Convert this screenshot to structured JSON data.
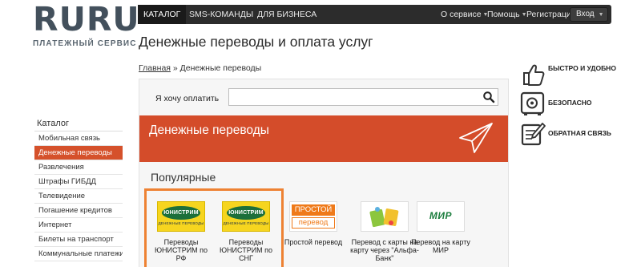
{
  "logo": {
    "word": "RURU",
    "subtitle": "ПЛАТЕЖНЫЙ СЕРВИС"
  },
  "nav": {
    "items": [
      {
        "label": "КАТАЛОГ"
      },
      {
        "label": "SMS-КОМАНДЫ"
      },
      {
        "label": "ДЛЯ БИЗНЕСА"
      }
    ],
    "right": [
      {
        "label": "О сервисе"
      },
      {
        "label": "Помощь"
      },
      {
        "label": "Регистрация"
      }
    ],
    "login_label": "Вход"
  },
  "page": {
    "title": "Денежные переводы и оплата услуг"
  },
  "breadcrumb": {
    "home": "Главная",
    "separator": "»",
    "current": "Денежные переводы"
  },
  "sidebar": {
    "title": "Каталог",
    "items": [
      {
        "label": "Мобильная связь"
      },
      {
        "label": "Денежные переводы",
        "active": true
      },
      {
        "label": "Развлечения"
      },
      {
        "label": "Штрафы ГИБДД"
      },
      {
        "label": "Телевидение"
      },
      {
        "label": "Погашение кредитов"
      },
      {
        "label": "Интернет"
      },
      {
        "label": "Билеты на транспорт"
      },
      {
        "label": "Коммунальные платежи,"
      }
    ]
  },
  "search": {
    "label": "Я хочу оплатить",
    "value": "",
    "placeholder": ""
  },
  "banner": {
    "title": "Денежные переводы"
  },
  "popular": {
    "title": "Популярные",
    "services": [
      {
        "caption": "Переводы ЮНИСТРИМ по РФ",
        "logo_text": "ЮНИСТРИМ",
        "logo_sub": "ДЕНЕЖНЫЕ ПЕРЕВОДЫ"
      },
      {
        "caption": "Переводы ЮНИСТРИМ по СНГ",
        "logo_text": "ЮНИСТРИМ",
        "logo_sub": "ДЕНЕЖНЫЕ ПЕРЕВОДЫ"
      },
      {
        "caption": "Простой перевод",
        "logo_line1": "ПРОСТОЙ",
        "logo_line2": "перевод"
      },
      {
        "caption": "Перевод с карты на карту через \"Альфа-Банк\""
      },
      {
        "caption": "Перевод на карту МИР",
        "logo_text": "МИР"
      }
    ]
  },
  "features": [
    {
      "label": "БЫСТРО И УДОБНО",
      "icon": "thumbs-up-icon"
    },
    {
      "label": "БЕЗОПАСНО",
      "icon": "safe-icon"
    },
    {
      "label": "ОБРАТНАЯ СВЯЗЬ",
      "icon": "feedback-icon"
    }
  ],
  "colors": {
    "accent": "#d44c2a",
    "highlight": "#ee8233",
    "navbar": "#2c2c2c",
    "logo": "#43505c"
  }
}
